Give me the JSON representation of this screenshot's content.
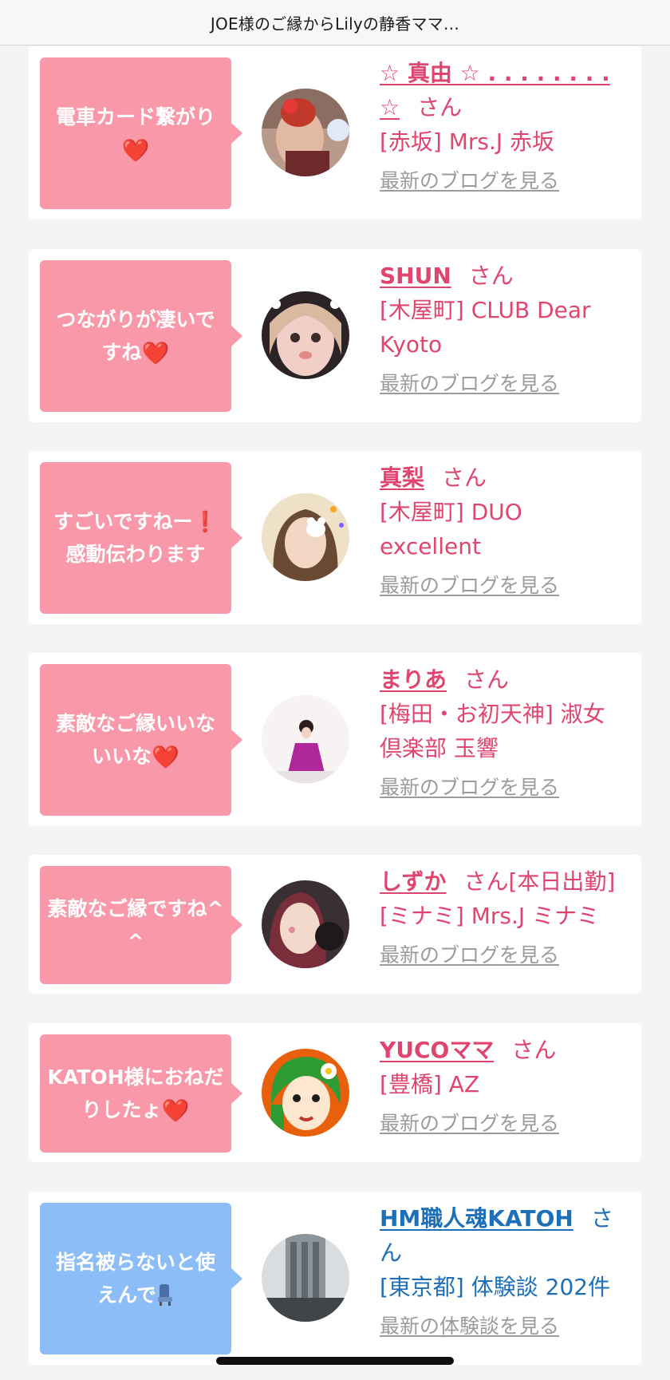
{
  "header": {
    "title": "JOE様のご縁からLilyの静香ママ…"
  },
  "cards": [
    {
      "message": "電車カード繋がり",
      "message_suffix": "❤️",
      "name": "☆ 真由 ☆ . . . . . . . . ☆",
      "honorific": "さん",
      "status": "",
      "shop": "[赤坂] Mrs.J 赤坂",
      "link": "最新のブログを見る",
      "theme": "pink"
    },
    {
      "message": "つながりが凄いですね",
      "message_suffix": "❤️",
      "name": "SHUN",
      "honorific": "さん",
      "status": "",
      "shop": "[木屋町] CLUB Dear Kyoto",
      "link": "最新のブログを見る",
      "theme": "pink"
    },
    {
      "message": "すごいですねー",
      "message_suffix": "❗",
      "message_line2": "感動伝わります",
      "name": "真梨",
      "honorific": "さん",
      "status": "",
      "shop": "[木屋町] DUO excellent",
      "link": "最新のブログを見る",
      "theme": "pink"
    },
    {
      "message": "素敵なご縁いいないいな",
      "message_suffix": "❤️",
      "name": "まりあ",
      "honorific": "さん",
      "status": "",
      "shop": "[梅田・お初天神] 淑女倶楽部 玉響",
      "link": "最新のブログを見る",
      "theme": "pink"
    },
    {
      "message": "素敵なご縁ですね^ ^",
      "message_suffix": "",
      "name": "しずか",
      "honorific": "さん",
      "status": "[本日出勤]",
      "shop": "[ミナミ] Mrs.J ミナミ",
      "link": "最新のブログを見る",
      "theme": "pink"
    },
    {
      "message": "KATOH様におねだりしたょ",
      "message_suffix": "❤️",
      "name": "YUCOママ",
      "honorific": "さん",
      "status": "",
      "shop": "[豊橋] AZ",
      "link": "最新のブログを見る",
      "theme": "pink"
    },
    {
      "message": "指名被らないと使えんで",
      "message_suffix": "",
      "name": "HM職人魂KATOH",
      "honorific": "さん",
      "status": "",
      "shop": "[東京都] 体験談 202件",
      "link": "最新の体験談を見る",
      "theme": "blue"
    }
  ],
  "colors": {
    "pink_bubble": "#f998a8",
    "blue_bubble": "#8cbdf6",
    "pink_text": "#e0456f",
    "blue_text": "#1e6fb8",
    "link_gray": "#9b9b9b",
    "background": "#f4f4f4"
  },
  "icons": {
    "heart": "heart-emoji-icon",
    "exclamation": "red-exclamation-icon",
    "seat": "seat-emoji-icon"
  }
}
